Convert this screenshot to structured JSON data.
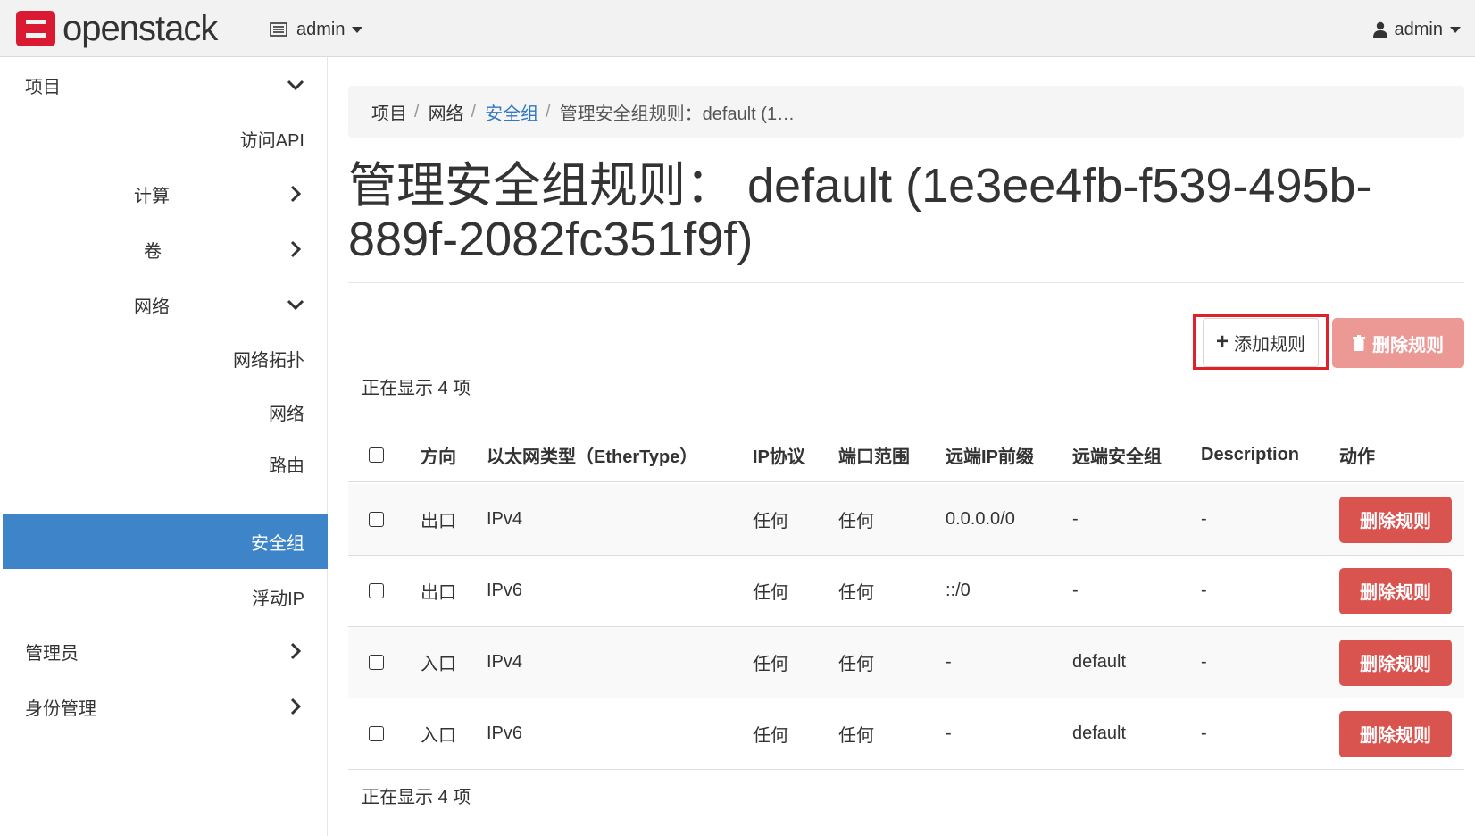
{
  "navbar": {
    "brand": "openstack",
    "project_label": "admin",
    "user_label": "admin"
  },
  "sidebar": {
    "project": "项目",
    "access_api": "访问API",
    "compute": "计算",
    "volumes": "卷",
    "network": "网络",
    "network_topology": "网络拓扑",
    "networks": "网络",
    "routers": "路由",
    "security_groups": "安全组",
    "floating_ips": "浮动IP",
    "admin": "管理员",
    "identity": "身份管理"
  },
  "breadcrumb": {
    "item1": "项目",
    "item2": "网络",
    "item3": "安全组",
    "current": "管理安全组规则：default (1…"
  },
  "page": {
    "title": "管理安全组规则： default (1e3ee4fb-f539-495b-889f-2082fc351f9f)",
    "add_rule": "添加规则",
    "delete_rules": "删除规则",
    "count_top": "正在显示 4 项",
    "count_bottom": "正在显示 4 项"
  },
  "table": {
    "headers": {
      "direction": "方向",
      "ethertype": "以太网类型（EtherType）",
      "protocol": "IP协议",
      "port_range": "端口范围",
      "remote_ip": "远端IP前缀",
      "remote_sg": "远端安全组",
      "description": "Description",
      "actions": "动作"
    },
    "rows": [
      {
        "direction": "出口",
        "ethertype": "IPv4",
        "protocol": "任何",
        "port_range": "任何",
        "remote_ip": "0.0.0.0/0",
        "remote_sg": "-",
        "description": "-",
        "action": "删除规则"
      },
      {
        "direction": "出口",
        "ethertype": "IPv6",
        "protocol": "任何",
        "port_range": "任何",
        "remote_ip": "::/0",
        "remote_sg": "-",
        "description": "-",
        "action": "删除规则"
      },
      {
        "direction": "入口",
        "ethertype": "IPv4",
        "protocol": "任何",
        "port_range": "任何",
        "remote_ip": "-",
        "remote_sg": "default",
        "description": "-",
        "action": "删除规则"
      },
      {
        "direction": "入口",
        "ethertype": "IPv6",
        "protocol": "任何",
        "port_range": "任何",
        "remote_ip": "-",
        "remote_sg": "default",
        "description": "-",
        "action": "删除规则"
      }
    ]
  },
  "colors": {
    "active_nav": "#3e84c8",
    "danger": "#d9534f",
    "danger_disabled": "#ec9996",
    "highlight_box": "#e0202a",
    "brand_red": "#da1a32"
  }
}
